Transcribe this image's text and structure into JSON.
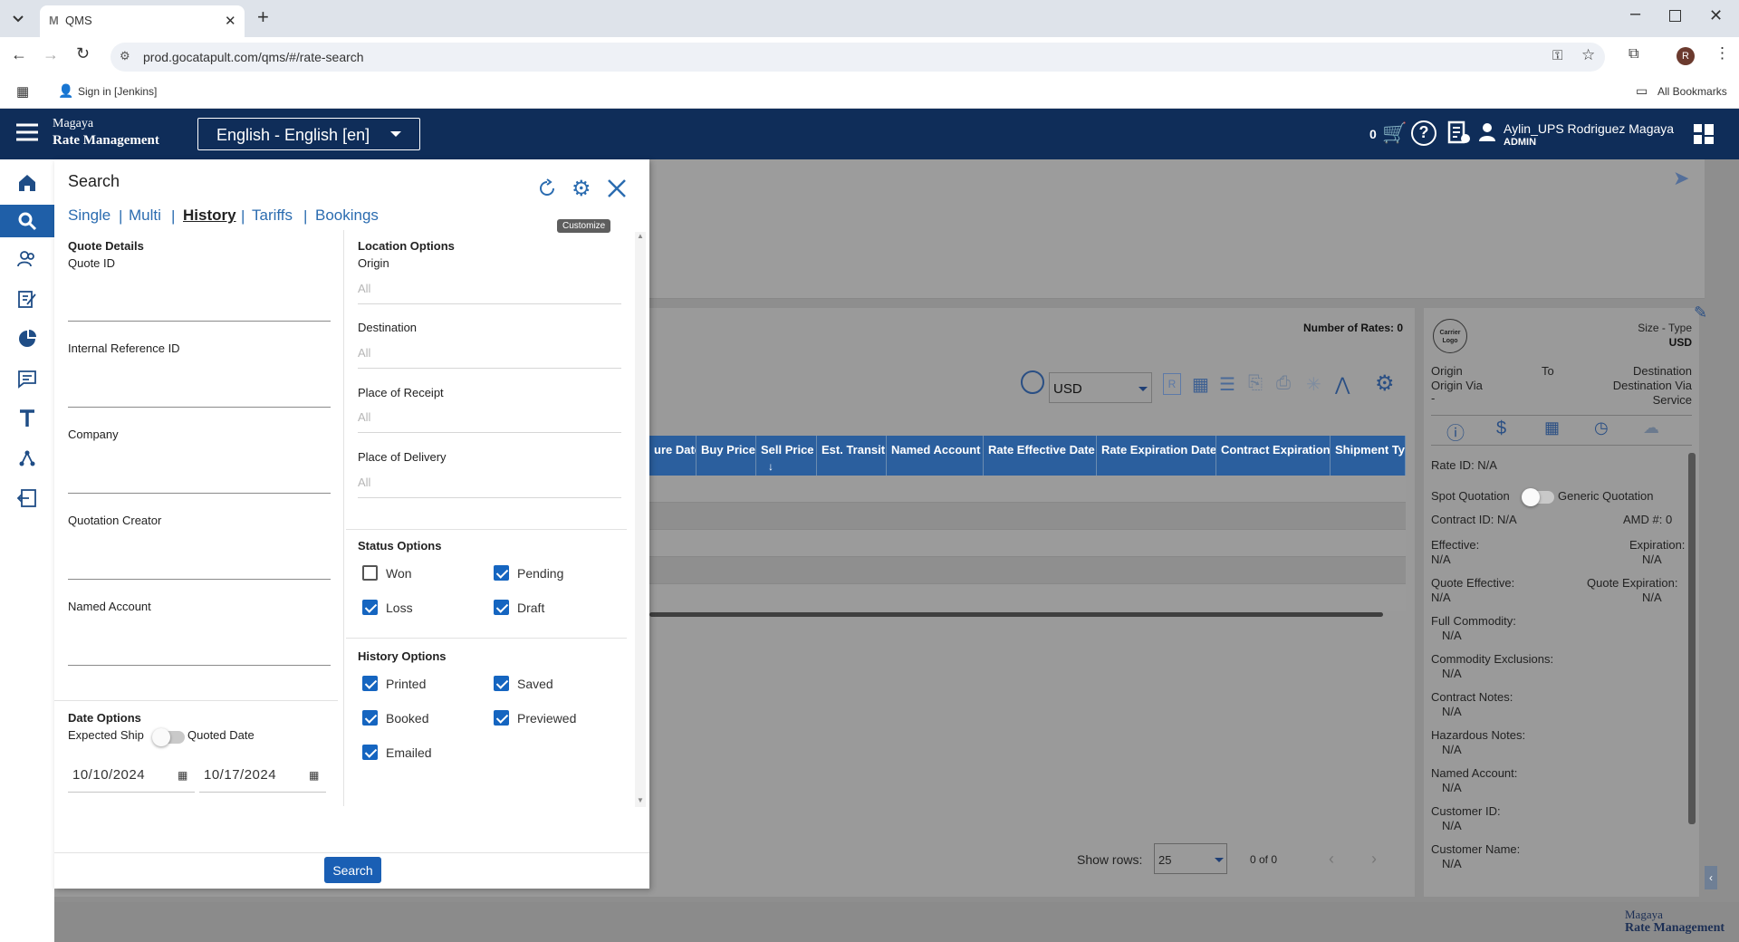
{
  "browser": {
    "tab_title": "QMS",
    "url": "prod.gocatapult.com/qms/#/rate-search",
    "bookmark": "Sign in [Jenkins]",
    "all_bookmarks": "All Bookmarks",
    "profile_initial": "R"
  },
  "header": {
    "brand_line1": "Magaya",
    "brand_line2": "Rate Management",
    "language": "English - English [en]",
    "cart_count": "0",
    "user_name": "Aylin_UPS Rodriguez Magaya",
    "user_role": "ADMIN"
  },
  "search_panel": {
    "title": "Search",
    "tooltip": "Customize",
    "tabs": [
      "Single",
      "Multi",
      "History",
      "Tariffs",
      "Bookings"
    ],
    "active_tab": "History",
    "quote_details": {
      "heading": "Quote Details",
      "fields": [
        "Quote ID",
        "Internal Reference ID",
        "Company",
        "Quotation Creator",
        "Named Account"
      ]
    },
    "date_options": {
      "heading": "Date Options",
      "toggle_left": "Expected Ship",
      "toggle_right": "Quoted Date",
      "from": "10/10/2024",
      "to": "10/17/2024"
    },
    "location_options": {
      "heading": "Location Options",
      "fields": [
        {
          "label": "Origin",
          "placeholder": "All"
        },
        {
          "label": "Destination",
          "placeholder": "All"
        },
        {
          "label": "Place of Receipt",
          "placeholder": "All"
        },
        {
          "label": "Place of Delivery",
          "placeholder": "All"
        }
      ]
    },
    "status_options": {
      "heading": "Status Options",
      "items": [
        {
          "label": "Won",
          "checked": false
        },
        {
          "label": "Pending",
          "checked": true
        },
        {
          "label": "Loss",
          "checked": true
        },
        {
          "label": "Draft",
          "checked": true
        }
      ]
    },
    "history_options": {
      "heading": "History Options",
      "items": [
        {
          "label": "Printed",
          "checked": true
        },
        {
          "label": "Saved",
          "checked": true
        },
        {
          "label": "Booked",
          "checked": true
        },
        {
          "label": "Previewed",
          "checked": true
        },
        {
          "label": "Emailed",
          "checked": true
        }
      ]
    },
    "search_button": "Search"
  },
  "results": {
    "number_of_rates_label": "Number of Rates: 0",
    "currency": "USD",
    "columns": [
      "ure Date",
      "Buy Price",
      "Sell Price",
      "Est. Transit",
      "Named Account",
      "Rate Effective Date",
      "Rate Expiration Date",
      "Contract Expiration",
      "Shipment Ty"
    ],
    "show_rows_label": "Show rows:",
    "rows_per_page": "25",
    "pagination": "0 of 0"
  },
  "details": {
    "carrier_logo": "Carrier Logo",
    "size_type_label": "Size - Type",
    "currency": "USD",
    "origin": "Origin",
    "to": "To",
    "destination": "Destination",
    "origin_via": "Origin Via",
    "destination_via": "Destination Via",
    "dash": "-",
    "service": "Service",
    "rate_id": "Rate ID: N/A",
    "spot_quotation": "Spot Quotation",
    "generic_quotation": "Generic Quotation",
    "contract_id": "Contract ID: N/A",
    "amd": "AMD #: 0",
    "effective_label": "Effective:",
    "effective_value": "N/A",
    "expiration_label": "Expiration:",
    "expiration_value": "N/A",
    "quote_effective_label": "Quote Effective:",
    "quote_effective_value": "N/A",
    "quote_expiration_label": "Quote Expiration:",
    "quote_expiration_value": "N/A",
    "fields": [
      {
        "label": "Full Commodity:",
        "value": "N/A"
      },
      {
        "label": "Commodity Exclusions:",
        "value": "N/A"
      },
      {
        "label": "Contract Notes:",
        "value": "N/A"
      },
      {
        "label": "Hazardous Notes:",
        "value": "N/A"
      },
      {
        "label": "Named Account:",
        "value": "N/A"
      },
      {
        "label": "Customer ID:",
        "value": "N/A"
      },
      {
        "label": "Customer Name:",
        "value": "N/A"
      }
    ]
  },
  "footer": {
    "brand_line1": "Magaya",
    "brand_line2": "Rate Management"
  }
}
